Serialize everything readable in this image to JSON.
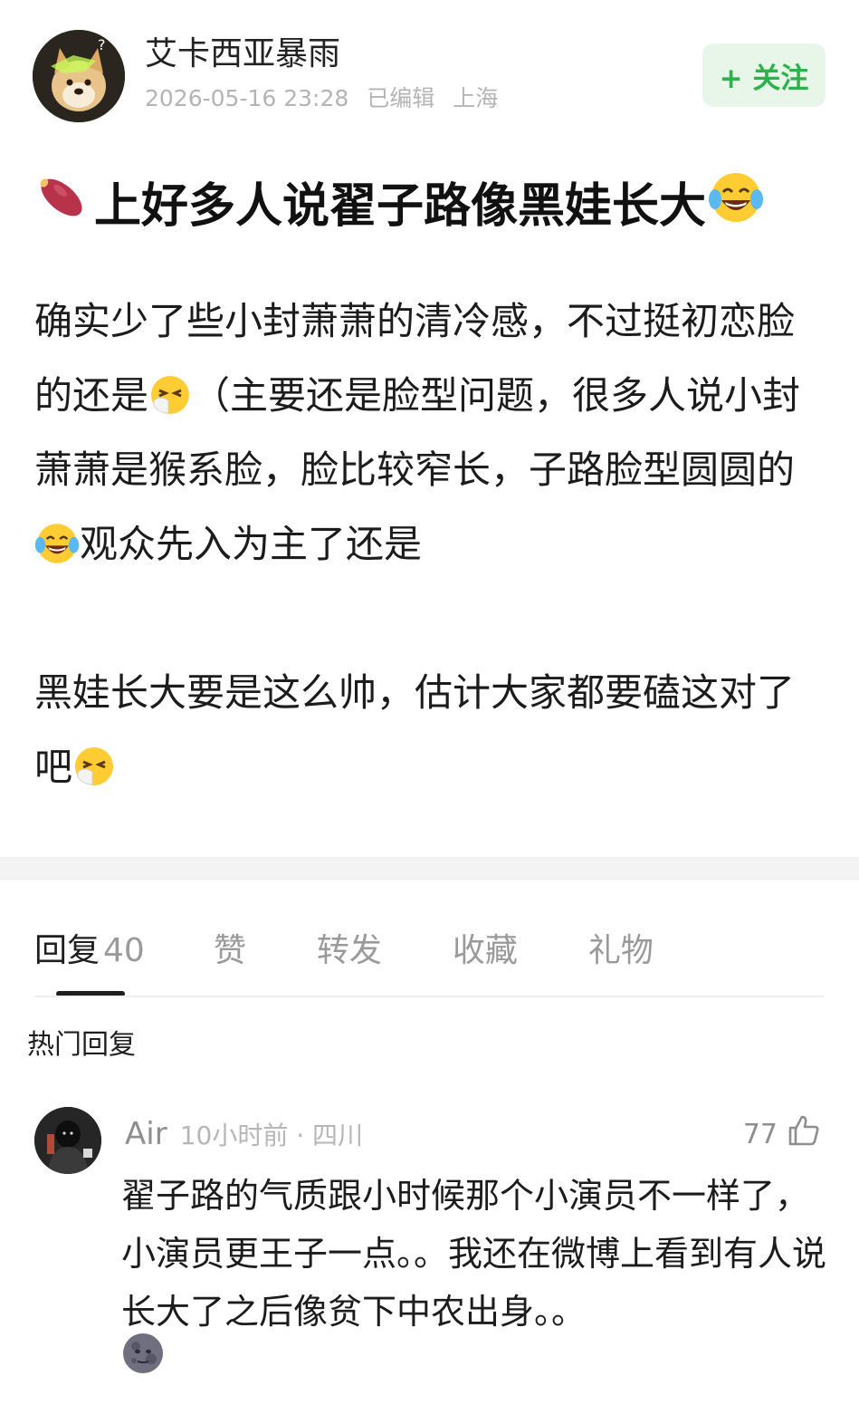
{
  "header": {
    "author_name": "艾卡西亚暴雨",
    "date": "2026-05-16 23:28",
    "edited": "已编辑",
    "location": "上海",
    "follow_label": "+ 关注"
  },
  "post": {
    "title": "上好多人说翟子路像黑娃长大",
    "title_lead_icon": "sweet-potato-emoji",
    "title_trail_icon": "tears-of-joy-emoji",
    "p1": {
      "s1": "确实少了些小封萧萧的清冷感，不过挺初恋脸的还是",
      "s2": "（主要还是脸型问题，很多人说小封萧萧是猴系脸，脸比较窄长，子路脸型圆圆的",
      "s3": "观众先入为主了还是"
    },
    "p2": {
      "s1": "黑娃长大要是这么帅，估计大家都要磕这对了吧"
    }
  },
  "tabs": [
    {
      "label": "回复",
      "count": "40"
    },
    {
      "label": "赞"
    },
    {
      "label": "转发"
    },
    {
      "label": "收藏"
    },
    {
      "label": "礼物"
    }
  ],
  "hot_replies_label": "热门回复",
  "comment": {
    "user": "Air",
    "time": "10小时前",
    "location": "四川",
    "likes": "77",
    "text": "翟子路的气质跟小时候那个小演员不一样了，小演员更王子一点。。我还在微博上看到有人说长大了之后像贫下中农出身。。",
    "trail_icon": "dark-moon-face-emoji"
  },
  "colors": {
    "follow_text": "#2eb14a",
    "follow_bg": "#e8f6ea",
    "meta_gray": "#b4b4b4",
    "tab_gray": "#9a9a9a"
  }
}
